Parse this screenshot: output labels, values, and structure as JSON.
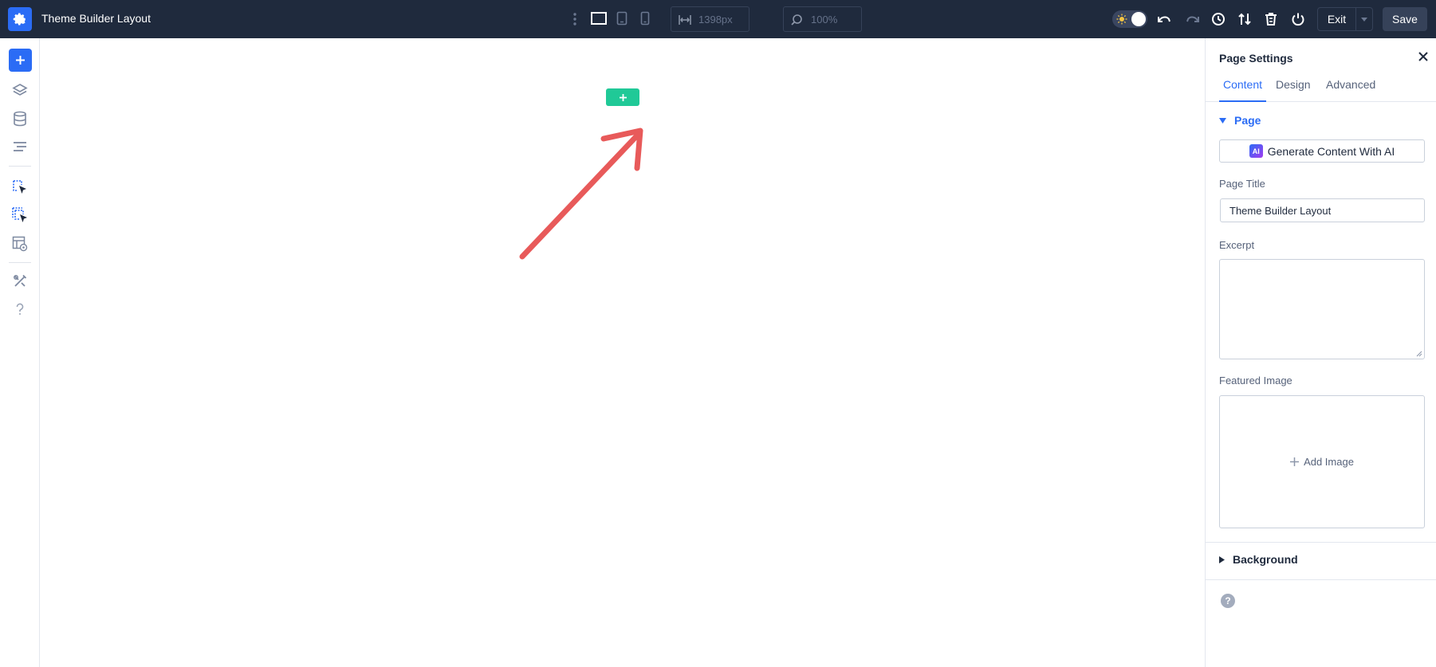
{
  "app": {
    "title": "Theme Builder Layout",
    "accent_color": "#2b6cf5",
    "topbar_color": "#1f2a3d",
    "add_section_color": "#20c997",
    "annotation_arrow_color": "#e85a5a"
  },
  "toolbar": {
    "more_icon": "vertical-dots-icon",
    "devices": [
      "desktop-icon",
      "tablet-icon",
      "phone-icon"
    ],
    "width_placeholder": "1398px",
    "zoom_placeholder": "100%",
    "theme_toggle_icon": "sun-icon",
    "actions": [
      "undo-icon",
      "redo-icon",
      "history-icon",
      "portability-icon",
      "trash-icon",
      "power-icon"
    ],
    "exit_label": "Exit",
    "save_label": "Save"
  },
  "sidebar": {
    "icons": [
      "add-icon",
      "layers-icon",
      "database-icon",
      "menu-lines-icon",
      "select-cursor-icon",
      "multi-select-cursor-icon",
      "template-preview-icon",
      "tools-icon",
      "help-icon"
    ]
  },
  "panel": {
    "title": "Page Settings",
    "tabs": [
      {
        "label": "Content",
        "active": true
      },
      {
        "label": "Design",
        "active": false
      },
      {
        "label": "Advanced",
        "active": false
      }
    ],
    "group_label": "Page",
    "ai_badge": "AI",
    "ai_button_label": "Generate Content With AI",
    "page_title_label": "Page Title",
    "page_title_value": "Theme Builder Layout",
    "excerpt_label": "Excerpt",
    "featured_image_label": "Featured Image",
    "add_image_label": "Add Image",
    "background_label": "Background",
    "help_glyph": "?"
  }
}
